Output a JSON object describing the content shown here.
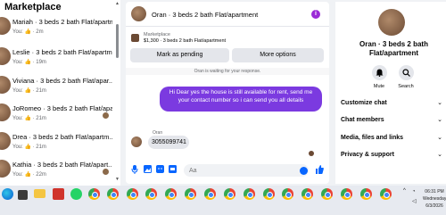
{
  "left_panel": {
    "title": "Marketplace",
    "conversations": [
      {
        "name": "Mariah · 3 beds 2 bath Flat/apartment",
        "meta": "You: 👍 · 2m"
      },
      {
        "name": "Leslie · 3 beds 2 bath Flat/apartment",
        "meta": "You: 👍 · 19m"
      },
      {
        "name": "Viviana · 3 beds 2 bath Flat/apar...",
        "meta": "You: 👍 · 21m"
      },
      {
        "name": "JoRomeo · 3 beds 2 bath Flat/apar...",
        "meta": "You: 👍 · 21m"
      },
      {
        "name": "Drea · 3 beds 2 bath Flat/apartm...",
        "meta": "You: 👍 · 21m"
      },
      {
        "name": "Kathia · 3 beds 2 bath Flat/apart...",
        "meta": "You: 👍 · 22m"
      }
    ]
  },
  "chat": {
    "header_title": "Oran · 3 beds 2 bath Flat/apartment",
    "listing_label": "Marketplace",
    "listing_price": "$1,300 · 3 beds 2 bath Flat/apartment",
    "mark_pending": "Mark as pending",
    "more_options": "More options",
    "waiting_banner": "Oran is waiting for your response.",
    "outgoing_message": "Hi Dear yes the house is still available for rent, send me your contact number so i can send you all details",
    "sender_name": "Oran",
    "incoming_message": "3055099741",
    "input_placeholder": "Aa"
  },
  "details": {
    "name": "Oran · 3 beds 2 bath Flat/apartment",
    "mute_label": "Mute",
    "search_label": "Search",
    "sections": [
      "Customize chat",
      "Chat members",
      "Media, files and links",
      "Privacy & support"
    ]
  },
  "taskbar": {
    "time": "06:31 PM",
    "day": "Wednesday",
    "date": "6/3/2026"
  },
  "colors": {
    "accent": "#7b3ae0",
    "brand_blue": "#0866ff",
    "info_icon": "#9b2bd6"
  }
}
